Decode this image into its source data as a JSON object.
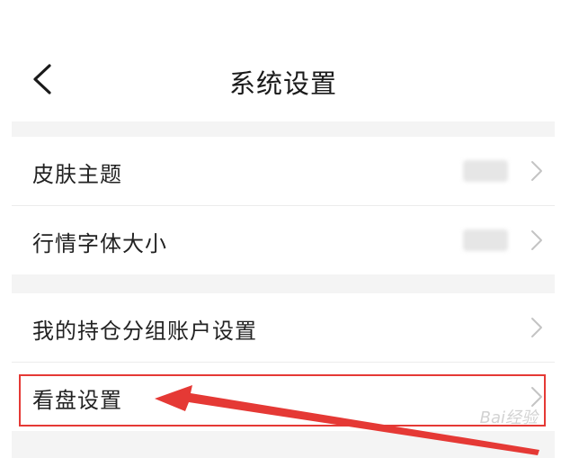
{
  "header": {
    "title": "系统设置"
  },
  "groups": [
    {
      "items": [
        {
          "label": "皮肤主题"
        },
        {
          "label": "行情字体大小"
        }
      ]
    },
    {
      "items": [
        {
          "label": "我的持仓分组账户设置"
        },
        {
          "label": "看盘设置"
        }
      ]
    }
  ],
  "watermark": "Bai经验",
  "colors": {
    "highlight": "#e53935",
    "background": "#f4f4f4"
  },
  "icons": {
    "back": "chevron-left-icon",
    "row": "chevron-right-icon"
  }
}
